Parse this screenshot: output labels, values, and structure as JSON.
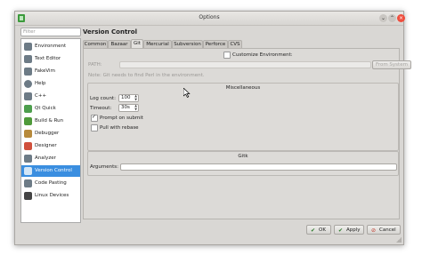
{
  "window": {
    "title": "Options",
    "buttons": [
      "chevron-down-icon",
      "chevron-up-icon",
      "close-icon"
    ]
  },
  "sidebar": {
    "filter_placeholder": "Filter",
    "items": [
      {
        "label": "Environment",
        "icon": "monitor-icon"
      },
      {
        "label": "Text Editor",
        "icon": "text-editor-icon"
      },
      {
        "label": "FakeVim",
        "icon": "fakevim-icon"
      },
      {
        "label": "Help",
        "icon": "help-icon"
      },
      {
        "label": "C++",
        "icon": "cpp-icon"
      },
      {
        "label": "Qt Quick",
        "icon": "qt-quick-icon"
      },
      {
        "label": "Build & Run",
        "icon": "build-run-icon"
      },
      {
        "label": "Debugger",
        "icon": "debugger-icon"
      },
      {
        "label": "Designer",
        "icon": "designer-icon"
      },
      {
        "label": "Analyzer",
        "icon": "analyzer-icon"
      },
      {
        "label": "Version Control",
        "icon": "version-control-icon",
        "selected": true
      },
      {
        "label": "Code Pasting",
        "icon": "code-pasting-icon"
      },
      {
        "label": "Linux Devices",
        "icon": "linux-devices-icon"
      }
    ]
  },
  "page": {
    "title": "Version Control",
    "tabs": [
      "Common",
      "Bazaar",
      "Git",
      "Mercurial",
      "Subversion",
      "Perforce",
      "CVS"
    ],
    "active_tab": "Git"
  },
  "git": {
    "customize_env_label": "Customize Environment:",
    "customize_env_checked": false,
    "path_label": "PATH:",
    "path_value": "",
    "from_system_label": "From System",
    "note": "Note: Git needs to find Perl in the environment.",
    "misc_title": "Miscellaneous",
    "log_count_label": "Log count:",
    "log_count_value": "100",
    "timeout_label": "Timeout:",
    "timeout_value": "30s",
    "prompt_on_submit_label": "Prompt on submit",
    "prompt_on_submit_checked": true,
    "pull_rebase_label": "Pull with rebase",
    "pull_rebase_checked": false,
    "gitk_title": "Gitk",
    "arguments_label": "Arguments:",
    "arguments_value": ""
  },
  "dialog_buttons": {
    "ok": "OK",
    "apply": "Apply",
    "cancel": "Cancel"
  },
  "colors": {
    "selection": "#3a8ee0",
    "window_bg": "#d9d7d4",
    "close_button": "#ef4e3e"
  }
}
